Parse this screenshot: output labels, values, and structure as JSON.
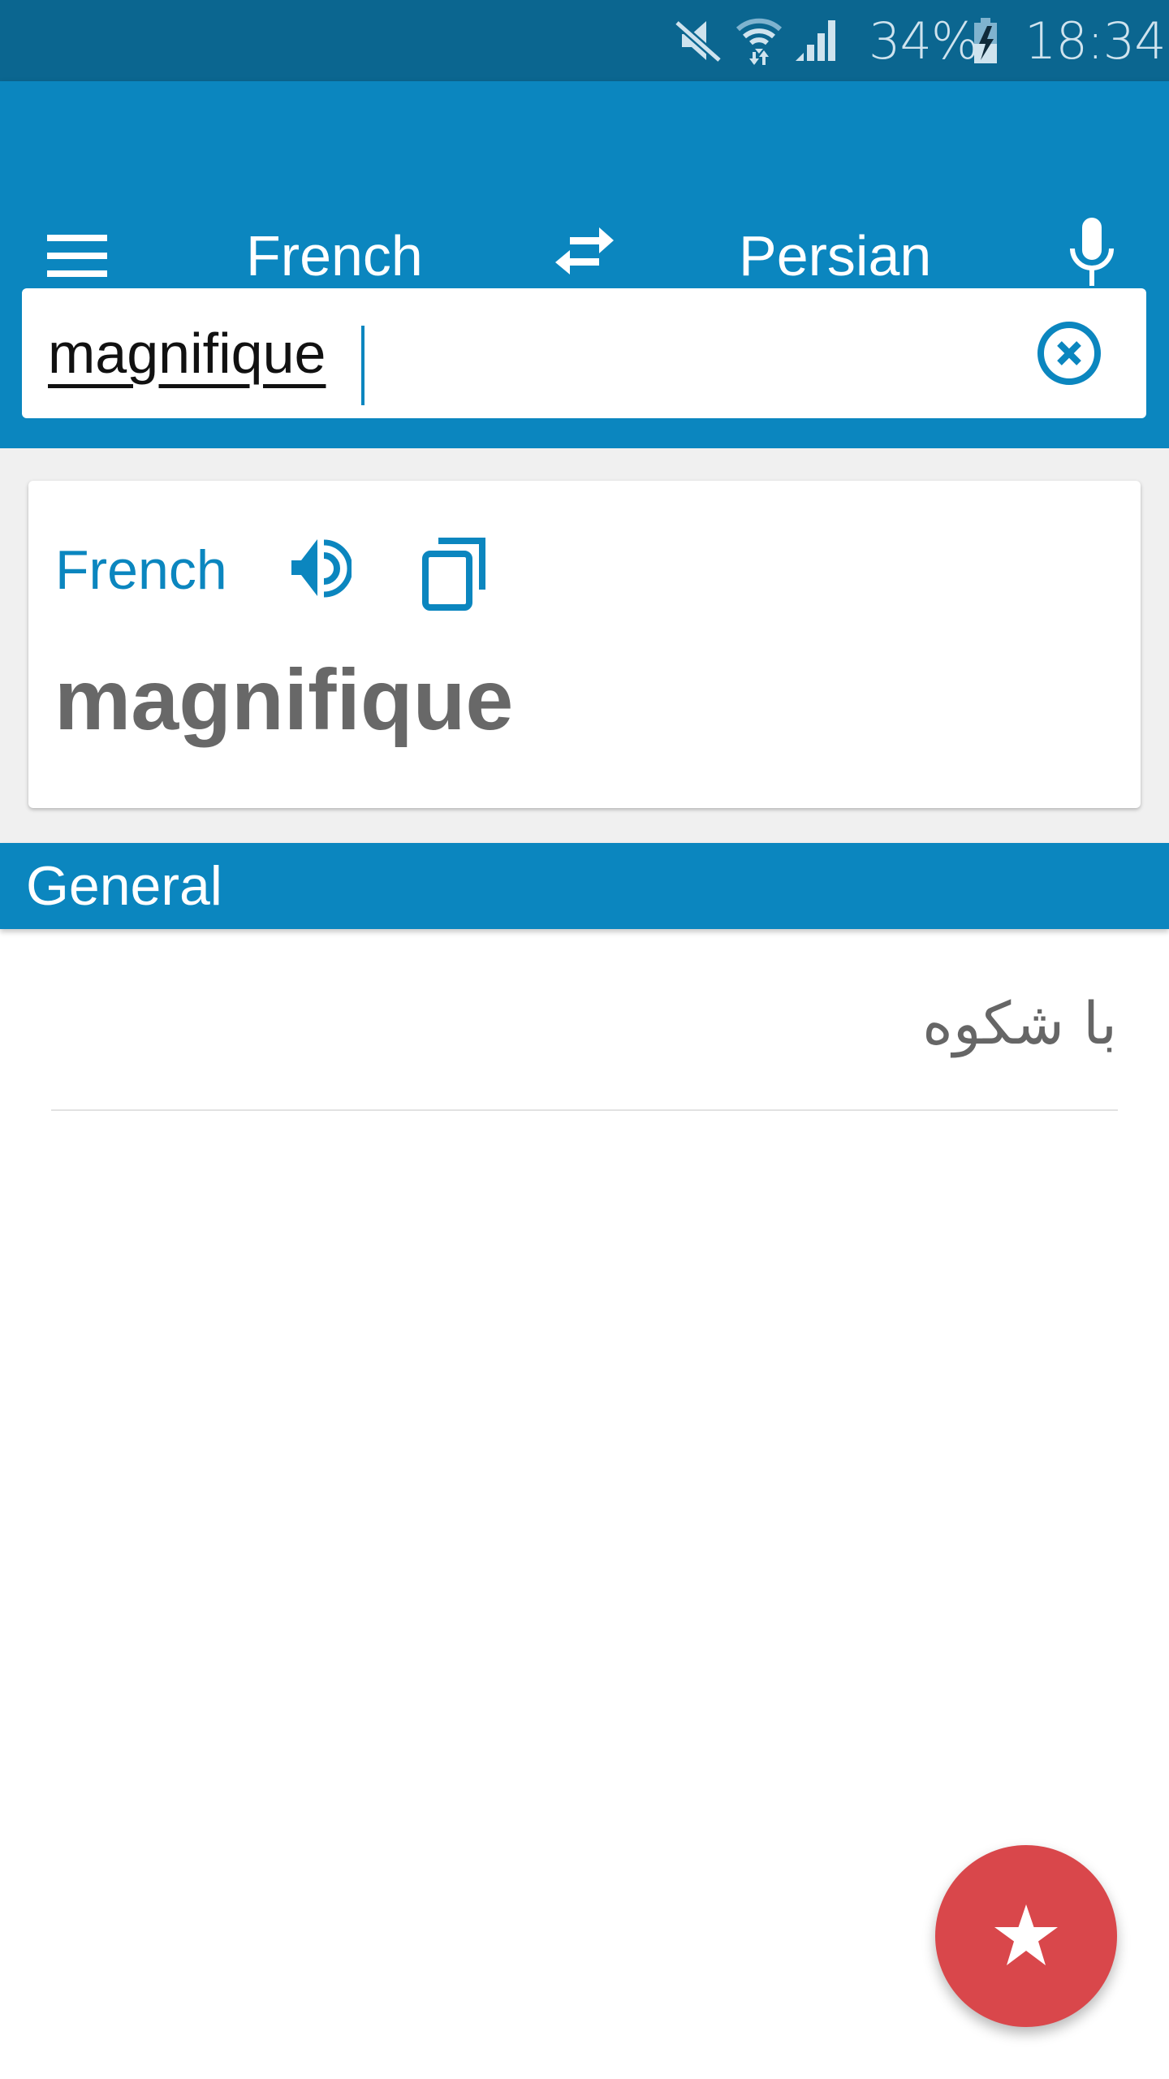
{
  "status_bar": {
    "icons": [
      "mute-icon",
      "wifi-icon",
      "signal-icon",
      "battery-charging-icon"
    ],
    "battery_percent": "34%",
    "time": "18:34"
  },
  "toolbar": {
    "menu_icon": "hamburger-menu-icon",
    "source_language": "French",
    "swap_icon": "swap-arrows-icon",
    "target_language": "Persian",
    "mic_icon": "microphone-icon"
  },
  "search": {
    "value": "magnifique",
    "placeholder": "",
    "clear_icon": "clear-circle-icon"
  },
  "card": {
    "language": "French",
    "speaker_icon": "speaker-icon",
    "copy_icon": "copy-icon",
    "word": "magnifique"
  },
  "results": {
    "section_title": "General",
    "items": [
      {
        "text": "با شکوه"
      }
    ]
  },
  "fab": {
    "icon": "star-icon",
    "label": "Favorite"
  },
  "colors": {
    "status_bar": "#0b6690",
    "primary": "#0b86bf",
    "fab": "#d9474b",
    "word_text": "#686868"
  }
}
